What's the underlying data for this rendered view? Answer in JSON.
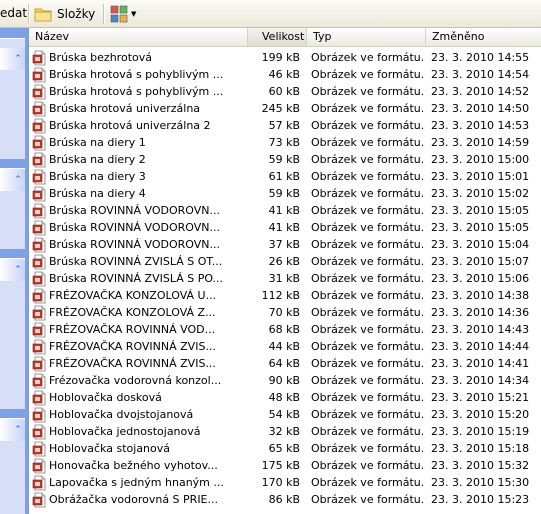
{
  "toolbar": {
    "search_label": "edat",
    "folders_label": "Složky"
  },
  "columns": {
    "name": "Název",
    "size": "Velikost",
    "type": "Typ",
    "modified": "Změněno"
  },
  "files": [
    {
      "name": "Brúska bezhrotová",
      "size": "199 kB",
      "type": "Obrázek ve formátu...",
      "modified": "23. 3. 2010 14:55"
    },
    {
      "name": "Brúska hrotová s pohyblivým ...",
      "size": "46 kB",
      "type": "Obrázek ve formátu...",
      "modified": "23. 3. 2010 14:54"
    },
    {
      "name": "Brúska hrotová s pohyblivým ...",
      "size": "60 kB",
      "type": "Obrázek ve formátu...",
      "modified": "23. 3. 2010 14:52"
    },
    {
      "name": "Brúska hrotová univerzálna",
      "size": "245 kB",
      "type": "Obrázek ve formátu...",
      "modified": "23. 3. 2010 14:50"
    },
    {
      "name": "Brúska hrotová univerzálna 2",
      "size": "57 kB",
      "type": "Obrázek ve formátu...",
      "modified": "23. 3. 2010 14:53"
    },
    {
      "name": "Brúska na diery 1",
      "size": "73 kB",
      "type": "Obrázek ve formátu...",
      "modified": "23. 3. 2010 14:59"
    },
    {
      "name": "Brúska na diery 2",
      "size": "59 kB",
      "type": "Obrázek ve formátu...",
      "modified": "23. 3. 2010 15:00"
    },
    {
      "name": "Brúska na diery 3",
      "size": "61 kB",
      "type": "Obrázek ve formátu...",
      "modified": "23. 3. 2010 15:01"
    },
    {
      "name": "Brúska na diery 4",
      "size": "59 kB",
      "type": "Obrázek ve formátu...",
      "modified": "23. 3. 2010 15:02"
    },
    {
      "name": "Brúska ROVINNÁ VODOROVN...",
      "size": "41 kB",
      "type": "Obrázek ve formátu...",
      "modified": "23. 3. 2010 15:05"
    },
    {
      "name": "Brúska ROVINNÁ VODOROVN...",
      "size": "41 kB",
      "type": "Obrázek ve formátu...",
      "modified": "23. 3. 2010 15:05"
    },
    {
      "name": "Brúska ROVINNÁ VODOROVN...",
      "size": "37 kB",
      "type": "Obrázek ve formátu...",
      "modified": "23. 3. 2010 15:04"
    },
    {
      "name": "Brúska ROVINNÁ ZVISLÁ S OT...",
      "size": "26 kB",
      "type": "Obrázek ve formátu...",
      "modified": "23. 3. 2010 15:07"
    },
    {
      "name": "Brúska ROVINNÁ ZVISLÁ S PO...",
      "size": "31 kB",
      "type": "Obrázek ve formátu...",
      "modified": "23. 3. 2010 15:06"
    },
    {
      "name": "FRÉZOVAČKA KONZOLOVÁ U...",
      "size": "112 kB",
      "type": "Obrázek ve formátu...",
      "modified": "23. 3. 2010 14:38"
    },
    {
      "name": "FRÉZOVAČKA KONZOLOVÁ Z...",
      "size": "70 kB",
      "type": "Obrázek ve formátu...",
      "modified": "23. 3. 2010 14:36"
    },
    {
      "name": "FRÉZOVAČKA ROVINNÁ VOD...",
      "size": "68 kB",
      "type": "Obrázek ve formátu...",
      "modified": "23. 3. 2010 14:43"
    },
    {
      "name": "FRÉZOVAČKA ROVINNÁ ZVIS...",
      "size": "44 kB",
      "type": "Obrázek ve formátu...",
      "modified": "23. 3. 2010 14:44"
    },
    {
      "name": "FRÉZOVAČKA ROVINNÁ ZVIS...",
      "size": "64 kB",
      "type": "Obrázek ve formátu...",
      "modified": "23. 3. 2010 14:41"
    },
    {
      "name": "Frézovačka vodorovná konzol...",
      "size": "90 kB",
      "type": "Obrázek ve formátu...",
      "modified": "23. 3. 2010 14:34"
    },
    {
      "name": "Hoblovačka dosková",
      "size": "48 kB",
      "type": "Obrázek ve formátu...",
      "modified": "23. 3. 2010 15:21"
    },
    {
      "name": "Hoblovačka dvojstojanová",
      "size": "54 kB",
      "type": "Obrázek ve formátu...",
      "modified": "23. 3. 2010 15:20"
    },
    {
      "name": "Hoblovačka jednostojanová",
      "size": "32 kB",
      "type": "Obrázek ve formátu...",
      "modified": "23. 3. 2010 15:19"
    },
    {
      "name": "Hoblovačka stojanová",
      "size": "65 kB",
      "type": "Obrázek ve formátu...",
      "modified": "23. 3. 2010 15:18"
    },
    {
      "name": "Honovačka bežného vyhotov...",
      "size": "175 kB",
      "type": "Obrázek ve formátu...",
      "modified": "23. 3. 2010 15:32"
    },
    {
      "name": "Lapovačka s jedným hnaným ...",
      "size": "170 kB",
      "type": "Obrázek ve formátu...",
      "modified": "23. 3. 2010 15:30"
    },
    {
      "name": "Obrážačka vodorovná S PRIE...",
      "size": "86 kB",
      "type": "Obrázek ve formátu...",
      "modified": "23. 3. 2010 15:23"
    }
  ]
}
